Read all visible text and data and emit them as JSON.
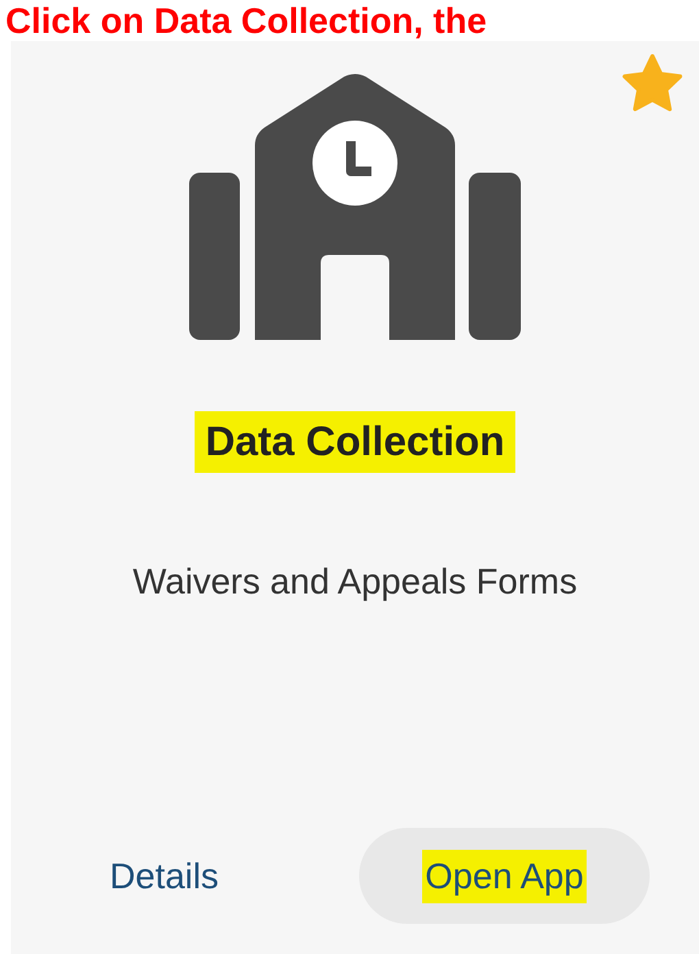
{
  "annotation": "Click on Data Collection, the",
  "card": {
    "favorite": true,
    "title": {
      "text": "Data Collection",
      "highlighted": true
    },
    "description": "Waivers and Appeals Forms",
    "details_link": "Details",
    "open_button": {
      "text": "Open App",
      "highlighted": true
    }
  }
}
